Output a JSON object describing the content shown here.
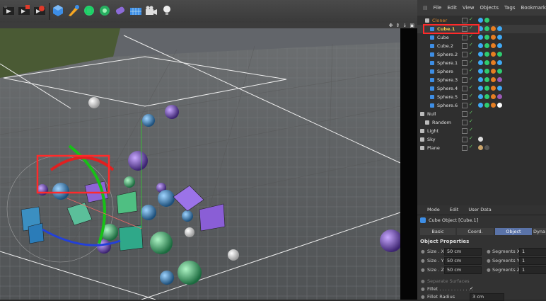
{
  "right_menu": [
    "File",
    "Edit",
    "View",
    "Objects",
    "Tags",
    "Bookmarks"
  ],
  "objects": [
    {
      "name": "Cloner",
      "indent": 1,
      "selected": false,
      "color": "#e58b2a",
      "tags": [
        "#3fa9f5",
        "#2ecc71"
      ]
    },
    {
      "name": "Cube.1",
      "indent": 2,
      "selected": true,
      "color": "#f2c94c",
      "tags": [
        "#3fa9f5",
        "#2ecc71",
        "#e67e22",
        "#3fa9f5"
      ]
    },
    {
      "name": "Cube",
      "indent": 2,
      "selected": false,
      "color": "#a9c8ff",
      "tags": [
        "#3fa9f5",
        "#2ecc71",
        "#e67e22",
        "#3fa9f5"
      ]
    },
    {
      "name": "Cube.2",
      "indent": 2,
      "selected": false,
      "color": "#a9c8ff",
      "tags": [
        "#3fa9f5",
        "#2ecc71",
        "#e67e22",
        "#3fa9f5"
      ]
    },
    {
      "name": "Sphere.2",
      "indent": 2,
      "selected": false,
      "color": "#a9c8ff",
      "tags": [
        "#3fa9f5",
        "#2ecc71",
        "#e67e22",
        "#2ecc71"
      ]
    },
    {
      "name": "Sphere.1",
      "indent": 2,
      "selected": false,
      "color": "#a9c8ff",
      "tags": [
        "#3fa9f5",
        "#2ecc71",
        "#e67e22",
        "#3fa9f5"
      ]
    },
    {
      "name": "Sphere",
      "indent": 2,
      "selected": false,
      "color": "#a9c8ff",
      "tags": [
        "#3fa9f5",
        "#2ecc71",
        "#e67e22",
        "#2ecc71"
      ]
    },
    {
      "name": "Sphere.3",
      "indent": 2,
      "selected": false,
      "color": "#a9c8ff",
      "tags": [
        "#3fa9f5",
        "#2ecc71",
        "#e67e22",
        "#9b59b6"
      ]
    },
    {
      "name": "Sphere.4",
      "indent": 2,
      "selected": false,
      "color": "#a9c8ff",
      "tags": [
        "#3fa9f5",
        "#2ecc71",
        "#e67e22",
        "#3fa9f5"
      ]
    },
    {
      "name": "Sphere.5",
      "indent": 2,
      "selected": false,
      "color": "#a9c8ff",
      "tags": [
        "#3fa9f5",
        "#2ecc71",
        "#e67e22",
        "#9b59b6"
      ]
    },
    {
      "name": "Sphere.6",
      "indent": 2,
      "selected": false,
      "color": "#a9c8ff",
      "tags": [
        "#3fa9f5",
        "#2ecc71",
        "#e67e22",
        "#ffffff"
      ]
    },
    {
      "name": "Null",
      "indent": 0,
      "selected": false,
      "color": "#dddddd",
      "tags": []
    },
    {
      "name": "Random",
      "indent": 1,
      "selected": false,
      "color": "#dddddd",
      "tags": []
    },
    {
      "name": "Light",
      "indent": 0,
      "selected": false,
      "color": "#dddddd",
      "tags": []
    },
    {
      "name": "Sky",
      "indent": 0,
      "selected": false,
      "color": "#dddddd",
      "tags": [
        "#dddddd"
      ]
    },
    {
      "name": "Plane",
      "indent": 0,
      "selected": false,
      "color": "#dddddd",
      "tags": [
        "#c9a36a",
        "#555555"
      ]
    }
  ],
  "attr": {
    "menu": [
      "Mode",
      "Edit",
      "User Data"
    ],
    "header": "Cube Object [Cube.1]",
    "tabs": [
      "Basic",
      "Coord.",
      "Object",
      "Dyna"
    ],
    "active_tab": "Object",
    "section": "Object Properties",
    "size": [
      {
        "label": "Size . X",
        "value": "50 cm"
      },
      {
        "label": "Size . Y",
        "value": "50 cm"
      },
      {
        "label": "Size . Z",
        "value": "50 cm"
      }
    ],
    "segments": [
      {
        "label": "Segments X",
        "value": "1"
      },
      {
        "label": "Segments Y",
        "value": "1"
      },
      {
        "label": "Segments Z",
        "value": "1"
      }
    ],
    "separate_surfaces": "Separate Surfaces",
    "fillet": "Fillet . . . . . . . . . . . .",
    "fillet_check": "✓",
    "fillet_radius_label": "Fillet Radius",
    "fillet_radius": "3 cm"
  },
  "viewport_nav": [
    "✥",
    "⇕",
    "↓",
    "▣"
  ],
  "colors": {
    "selection_outline": "#ff2a2a",
    "active_tab": "#5a73a8",
    "selected_label": "#f2c94c"
  }
}
